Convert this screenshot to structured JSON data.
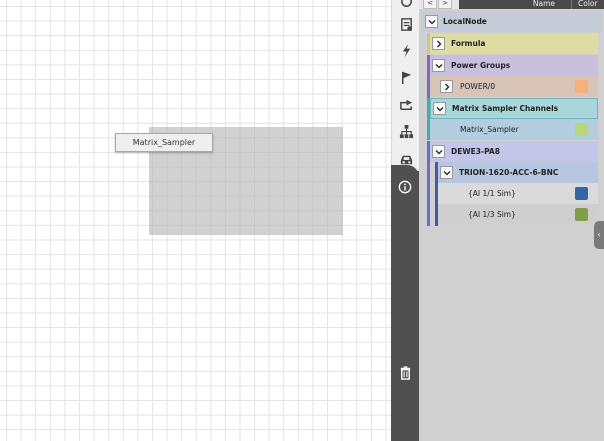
{
  "canvas": {
    "widget_title": "Matrix_Sampler"
  },
  "toolbar": {
    "icons": [
      "settings-icon",
      "report-icon",
      "lightning-icon",
      "flag-icon",
      "share-icon",
      "hierarchy-icon",
      "car-icon",
      "info-icon",
      "trash-icon"
    ]
  },
  "panel": {
    "nav_back": "<",
    "nav_forward": ">",
    "col_name": "Name",
    "col_color": "Color",
    "tree": {
      "local_node": "LocalNode",
      "formula": "Formula",
      "power_groups": "Power Groups",
      "power0": "POWER/0",
      "matrix_sampler_channels": "Matrix Sampler Channels",
      "matrix_sampler": "Matrix_Sampler",
      "dewe": "DEWE3-PA8",
      "trion": "TRION-1620-ACC-6-BNC",
      "ai1_1": "{AI 1/1 Sim}",
      "ai1_3": "{AI 1/3 Sim}"
    }
  },
  "colors": {
    "power0_swatch": "#f4b27a",
    "matrix_sampler_swatch": "#b9d678",
    "ai1_1_swatch": "#3665a8",
    "ai1_3_swatch": "#7f9e47"
  }
}
